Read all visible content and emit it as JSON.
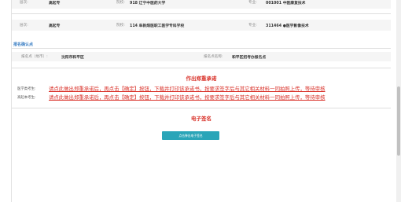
{
  "top_row": {
    "label1": "层次:",
    "value1": "高起专",
    "label2": "院校:",
    "value2": "918 辽宁中医药大学",
    "label3": "专业:",
    "value3": "001001 中医康复技术"
  },
  "row2": {
    "label1": "层次:",
    "value1": "高起专",
    "label2": "院校:",
    "value2": "114 阜新煤医职工医学专科学校",
    "label3": "专业:",
    "value3": "311464 ●医学影像技术"
  },
  "section": {
    "title": "报名确认点"
  },
  "confirm_row": {
    "label1": "报名点（地市）:",
    "value1": "沈阳市和平区",
    "label2": "报名点名称:",
    "value2": "和平区招考办报名点"
  },
  "commitment": {
    "title": "作出郑重承诺",
    "label_med": "医学类考生:",
    "label_upgrade": "高起本考生:",
    "notice_text": "请点此做出郑重承诺后，再点击【确定】按钮，下载并打印该承诺书，按要求签字后与其它相关材料一同拍照上传，等待审核"
  },
  "signature": {
    "title": "电子签名",
    "button_label": "点击弹出电子签名"
  }
}
